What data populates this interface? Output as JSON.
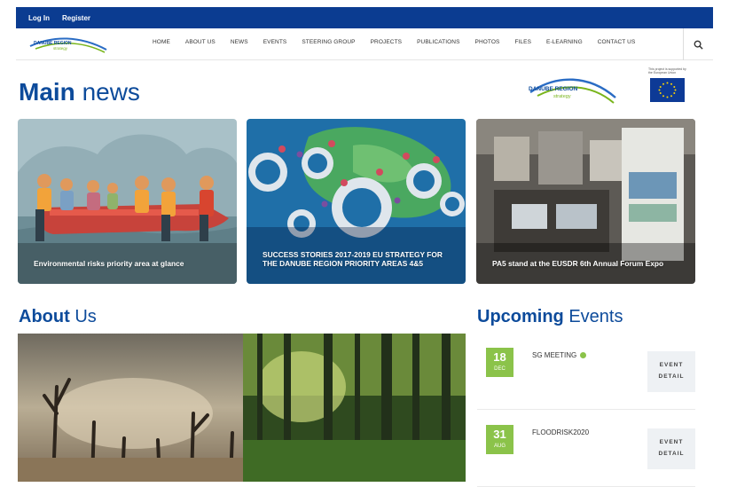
{
  "topbar": {
    "login": "Log In",
    "register": "Register"
  },
  "logo": {
    "line1": "DANUBE REGION",
    "line2": "strategy"
  },
  "nav": {
    "items": [
      "HOME",
      "ABOUT US",
      "NEWS",
      "EVENTS",
      "STEERING GROUP",
      "PROJECTS",
      "PUBLICATIONS",
      "PHOTOS",
      "FILES",
      "E-LEARNING",
      "CONTACT US"
    ]
  },
  "header": {
    "title_bold": "Main",
    "title_light": "news"
  },
  "partner": {
    "line1": "DANUBE REGION",
    "line2": "strategy",
    "eu_caption": "This project is supported by the European Union"
  },
  "news": [
    {
      "title": "Environmental risks priority area at glance"
    },
    {
      "title": "SUCCESS STORIES 2017-2019 EU STRATEGY FOR THE DANUBE REGION PRIORITY AREAS 4&5"
    },
    {
      "title": "PA5 stand at the EUSDR 6th Annual Forum Expo"
    }
  ],
  "about": {
    "title_bold": "About",
    "title_light": "Us"
  },
  "events": {
    "title_bold": "Upcoming",
    "title_light": "Events",
    "items": [
      {
        "day": "18",
        "month": "DEC",
        "title": "SG MEETING",
        "button_line1": "EVENT",
        "button_line2": "DETAIL"
      },
      {
        "day": "31",
        "month": "AUG",
        "title": "FLOODRISK2020",
        "button_line1": "EVENT",
        "button_line2": "DETAIL"
      }
    ]
  },
  "colors": {
    "brand": "#0b3c91",
    "heading": "#0d4b9b",
    "accent": "#8bc34a"
  },
  "icons": {
    "search": "search-icon"
  }
}
